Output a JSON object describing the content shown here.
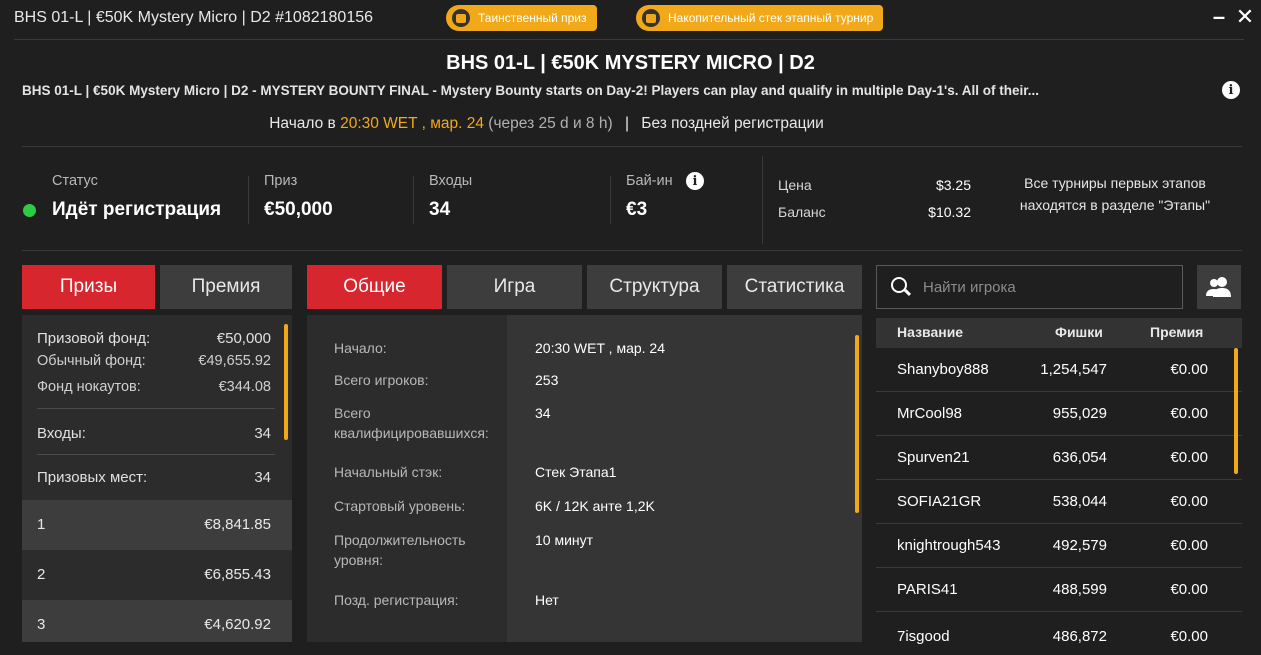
{
  "window": {
    "title": "BHS 01-L | €50K Mystery Micro | D2 #1082180156",
    "badges": [
      {
        "label": "Таинственный приз",
        "icon": "mystery-prize-icon"
      },
      {
        "label": "Накопительный стек этапный турнир",
        "icon": "stack-icon"
      }
    ],
    "minimize": "–",
    "close": "✕"
  },
  "header": {
    "title": "BHS 01-L | €50K MYSTERY MICRO | D2",
    "description": "BHS 01-L | €50K Mystery Micro | D2 - MYSTERY BOUNTY FINAL - Mystery Bounty starts on Day-2! Players can play and qualify in multiple Day-1's. All of their...",
    "start_prefix": "Начало в ",
    "start_time": "20:30 WET , мар. 24",
    "start_countdown": " (через 25 d и 8 h)",
    "separator": "|",
    "late_reg": "Без поздней регистрации"
  },
  "stats": {
    "status_label": "Статус",
    "status_value": "Идёт регистрация",
    "prize_label": "Приз",
    "prize_value": "€50,000",
    "entries_label": "Входы",
    "entries_value": "34",
    "buyin_label": "Бай-ин",
    "buyin_value": "€3",
    "price_label": "Цена",
    "price_value": "$3.25",
    "balance_label": "Баланс",
    "balance_value": "$10.32",
    "note": "Все турниры первых этапов находятся в разделе \"Этапы\""
  },
  "prize_tabs": [
    "Призы",
    "Премия"
  ],
  "info_tabs": [
    "Общие",
    "Игра",
    "Структура",
    "Статистика"
  ],
  "prizes": {
    "pool_label": "Призовой фонд:",
    "pool_value": "€50,000",
    "regular_label": "Обычный фонд:",
    "regular_value": "€49,655.92",
    "ko_label": "Фонд нокаутов:",
    "ko_value": "€344.08",
    "entries_label": "Входы:",
    "entries_value": "34",
    "places_label": "Призовых мест:",
    "places_value": "34",
    "ranks": [
      {
        "place": "1",
        "amount": "€8,841.85"
      },
      {
        "place": "2",
        "amount": "€6,855.43"
      },
      {
        "place": "3",
        "amount": "€4,620.92"
      }
    ]
  },
  "general": [
    {
      "label": "Начало:",
      "value": "20:30 WET , мар. 24"
    },
    {
      "label": "Всего игроков:",
      "value": "253"
    },
    {
      "label": "Всего квалифицировавшихся:",
      "value": "34"
    },
    {
      "label": "Начальный стэк:",
      "value": "Стек Этапа1"
    },
    {
      "label": "Стартовый уровень:",
      "value": "6K / 12K анте 1,2K"
    },
    {
      "label": "Продолжительность уровня:",
      "value": "10 минут"
    },
    {
      "label": "Позд. регистрация:",
      "value": "Нет"
    }
  ],
  "players": {
    "search_placeholder": "Найти игрока",
    "columns": [
      "Название",
      "Фишки",
      "Премия"
    ],
    "rows": [
      {
        "name": "Shanyboy888",
        "chips": "1,254,547",
        "prize": "€0.00"
      },
      {
        "name": "MrCool98",
        "chips": "955,029",
        "prize": "€0.00"
      },
      {
        "name": "Spurven21",
        "chips": "636,054",
        "prize": "€0.00"
      },
      {
        "name": "SOFIA21GR",
        "chips": "538,044",
        "prize": "€0.00"
      },
      {
        "name": "knightrough543",
        "chips": "492,579",
        "prize": "€0.00"
      },
      {
        "name": "PARIS41",
        "chips": "488,599",
        "prize": "€0.00"
      },
      {
        "name": "7isgood",
        "chips": "486,872",
        "prize": "€0.00"
      }
    ]
  },
  "colors": {
    "accent": "#f1a91a",
    "active_tab": "#d7262d",
    "status_green": "#2ecc40"
  }
}
